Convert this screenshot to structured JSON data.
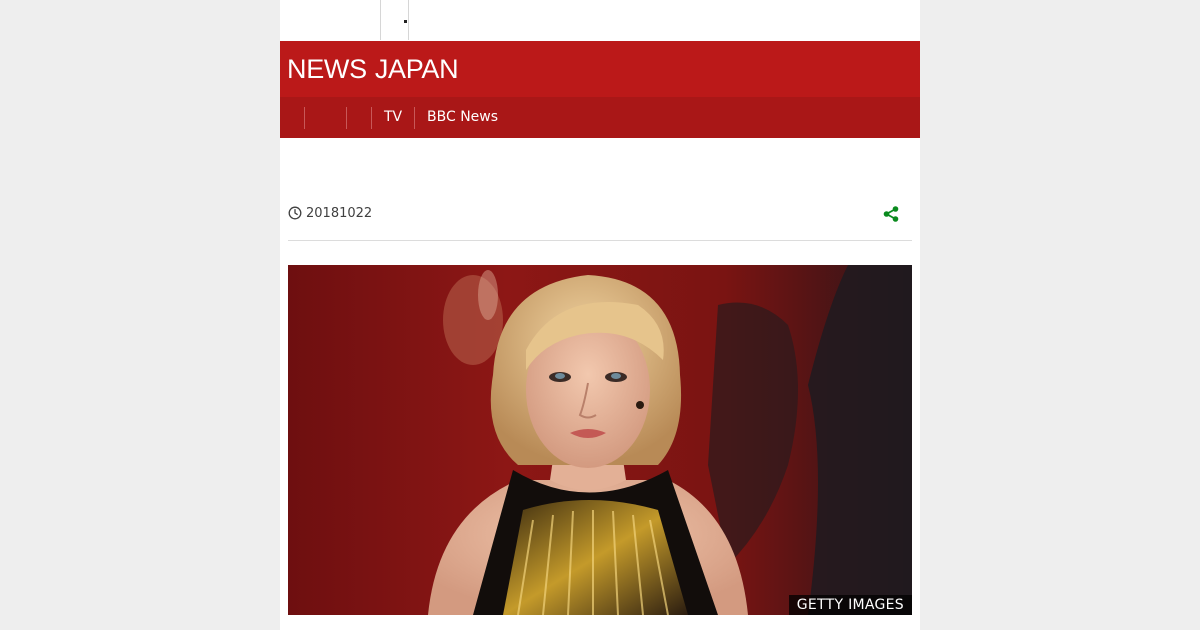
{
  "masthead": {
    "logo_bold": "NEWS",
    "logo_light": "JAPAN",
    "background": "#bb1919"
  },
  "nav": {
    "items": [
      "TV",
      "BBC News"
    ],
    "background": "#a91717"
  },
  "article": {
    "date": "20181022",
    "share_icon": "share-icon",
    "clock_icon": "clock-icon"
  },
  "image": {
    "credit": "GETTY IMAGES"
  },
  "colors": {
    "share": "#0a8a1e",
    "page_bg": "#eeeeee"
  }
}
